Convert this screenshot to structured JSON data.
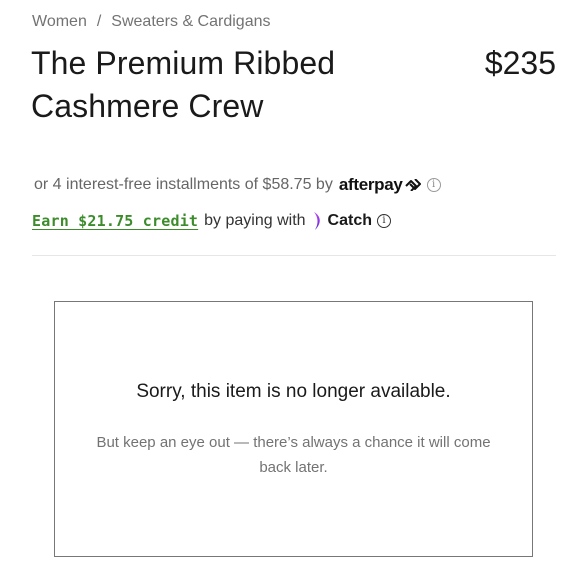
{
  "breadcrumb": {
    "items": [
      "Women",
      "Sweaters & Cardigans"
    ],
    "separator": "/"
  },
  "product": {
    "title": "The Premium Ribbed Cashmere Crew",
    "price": "$235"
  },
  "afterpay": {
    "text": "or 4 interest-free installments of $58.75 by",
    "logo_text": "afterpay",
    "info_icon": "info-icon"
  },
  "catch": {
    "earn_link": "Earn $21.75 credit",
    "text": "by paying with",
    "logo_text": "Catch",
    "info_icon": "info-icon",
    "link_color": "#3c8c2c",
    "brand_color": "#7b2ff7"
  },
  "notice": {
    "title": "Sorry, this item is no longer available.",
    "body": "But keep an eye out — there’s always a chance it will come back later."
  }
}
